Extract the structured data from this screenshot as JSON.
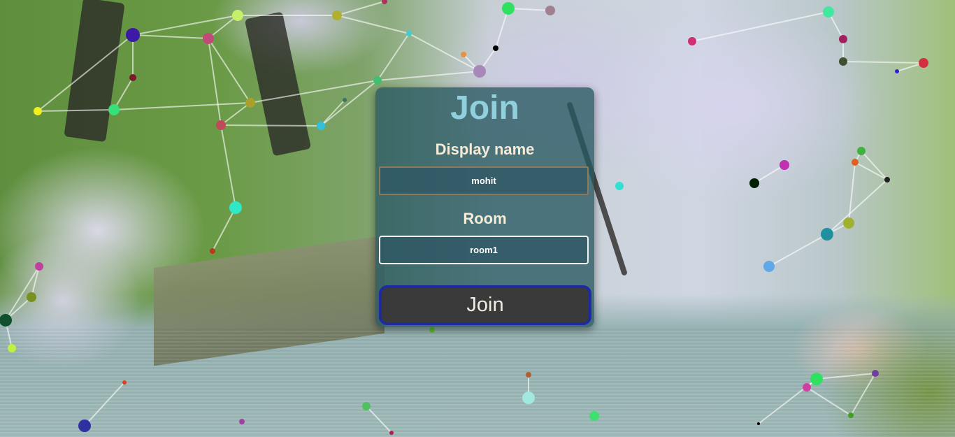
{
  "join_form": {
    "title": "Join",
    "display_name_label": "Display name",
    "display_name_value": "mohit",
    "room_label": "Room",
    "room_value": "room1",
    "join_button_label": "Join"
  },
  "theme": {
    "card_background": "#285862",
    "title_color": "#8fd0dc",
    "label_color": "#f4ecd8",
    "button_background": "#3a3a3a",
    "button_border": "#1f2aa0"
  }
}
